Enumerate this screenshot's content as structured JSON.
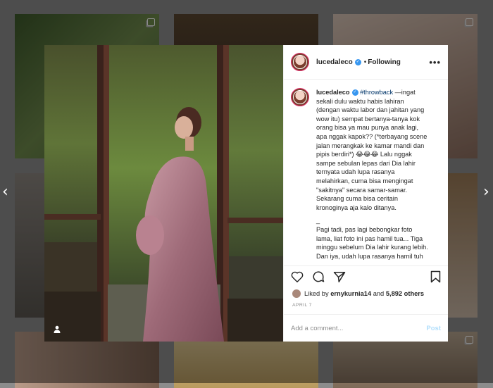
{
  "post": {
    "username": "lucedaleco",
    "follow_status": "Following",
    "separator": "•",
    "more": "•••",
    "caption_lines": [
      "sekali dulu waktu habis lahiran",
      "(dengan waktu labor dan jahitan yang",
      "wow itu) sempat bertanya-tanya kok",
      "orang bisa ya mau punya anak lagi,",
      "apa nggak kapok?? (*terbayang scene",
      "jalan merangkak ke kamar mandi dan",
      "pipis berdiri*) 😂😂😂 Lalu nggak",
      "sampe sebulan lepas dari Dia lahir",
      "ternyata udah lupa rasanya",
      "melahirkan, cuma bisa mengingat",
      "\"sakitnya\" secara samar-samar.",
      "Sekarang cuma bisa ceritain",
      "kronoginya aja kalo ditanya.",
      "_",
      "Pagi tadi, pas lagi bebongkar foto",
      "lama, liat foto ini pas hamil tua... Tiga",
      "minggu sebelum Dia lahir kurang lebih.",
      "Dan iya, udah lupa rasanya hamil tuh"
    ],
    "caption_hashtag": "#throwback",
    "caption_first_rest": " —ingat",
    "liked_prefix": "Liked by ",
    "liked_user": "ernykurnia14",
    "liked_and": " and ",
    "liked_count": "5,892 others",
    "date": "APRIL 7",
    "comment_placeholder": "Add a comment...",
    "post_button": "Post"
  },
  "nav": {
    "prev": "‹",
    "next": "›"
  },
  "colors": {
    "verified": "#3897f0",
    "post_disabled": "#b2dffc",
    "story_ring": "#e1306c"
  }
}
